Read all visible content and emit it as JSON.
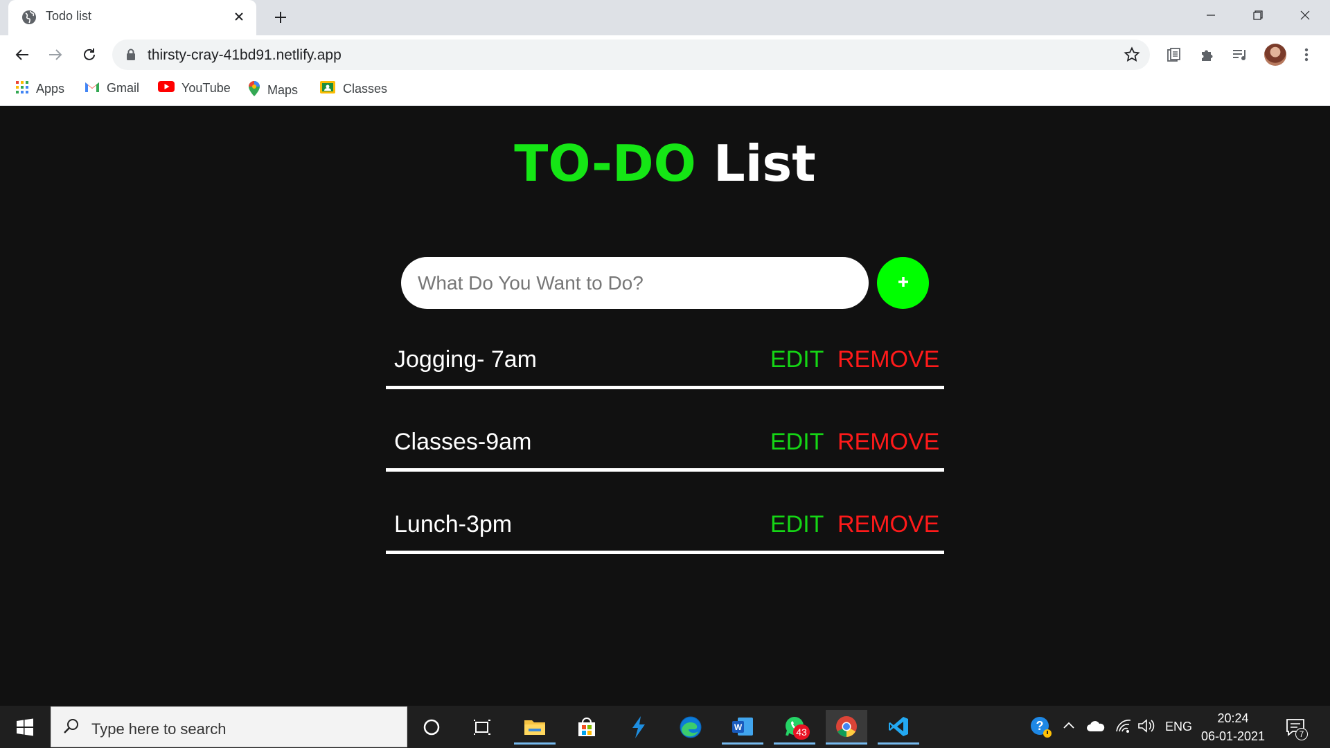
{
  "browser": {
    "tab_title": "Todo list",
    "url": "thirsty-cray-41bd91.netlify.app",
    "bookmarks": [
      {
        "label": "Apps",
        "icon": "apps-grid-icon"
      },
      {
        "label": "Gmail",
        "icon": "gmail-icon"
      },
      {
        "label": "YouTube",
        "icon": "youtube-icon"
      },
      {
        "label": "Maps",
        "icon": "maps-pin-icon"
      },
      {
        "label": "Classes",
        "icon": "classroom-icon"
      }
    ]
  },
  "app": {
    "title_accent": "TO-DO",
    "title_rest": " List",
    "accent_color": "#15e615",
    "input_placeholder": "What Do You Want to Do?",
    "input_value": "",
    "add_symbol": "+",
    "todos": [
      {
        "text": "Jogging- 7am",
        "edit_label": "EDIT",
        "remove_label": "REMOVE"
      },
      {
        "text": "Classes-9am",
        "edit_label": "EDIT",
        "remove_label": "REMOVE"
      },
      {
        "text": "Lunch-3pm",
        "edit_label": "EDIT",
        "remove_label": "REMOVE"
      }
    ]
  },
  "taskbar": {
    "search_placeholder": "Type here to search",
    "whatsapp_badge": "43",
    "language": "ENG",
    "time": "20:24",
    "date": "06-01-2021",
    "notification_count": "7"
  }
}
